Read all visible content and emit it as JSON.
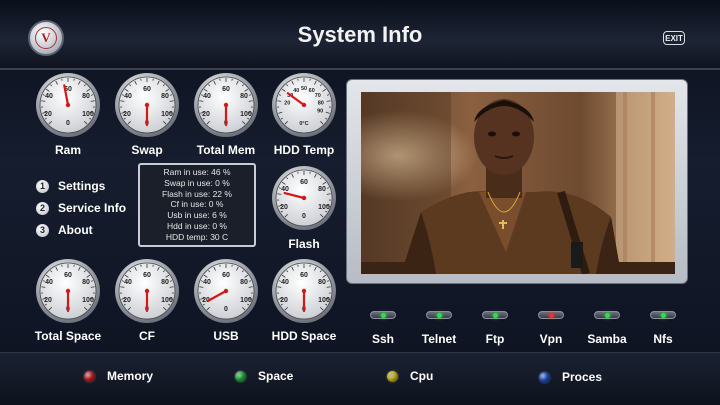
{
  "header": {
    "title": "System Info",
    "exit_label": "EXIT",
    "logo_letter": "V"
  },
  "gauges": [
    {
      "id": "ram",
      "label": "Ram",
      "percent": 46
    },
    {
      "id": "swap",
      "label": "Swap",
      "percent": 0
    },
    {
      "id": "total-mem",
      "label": "Total Mem",
      "percent": 0
    },
    {
      "id": "hdd-temp",
      "label": "HDD Temp",
      "percent": 30
    },
    {
      "id": "flash",
      "label": "Flash",
      "percent": 22
    },
    {
      "id": "total-space",
      "label": "Total Space",
      "percent": 0
    },
    {
      "id": "cf",
      "label": "CF",
      "percent": 0
    },
    {
      "id": "usb",
      "label": "USB",
      "percent": 6
    },
    {
      "id": "hdd-space",
      "label": "HDD Space",
      "percent": 0
    }
  ],
  "gauge_scale": [
    "20",
    "40",
    "60",
    "80",
    "100",
    "0"
  ],
  "temp_scale": [
    "20",
    "30",
    "40",
    "50",
    "60",
    "70",
    "80",
    "90",
    "0°C"
  ],
  "menu": [
    {
      "num": "1",
      "label": "Settings"
    },
    {
      "num": "2",
      "label": "Service Info"
    },
    {
      "num": "3",
      "label": "About"
    }
  ],
  "info": [
    "Ram in use: 46 %",
    "Swap in use: 0 %",
    "Flash in use: 22 %",
    "Cf in use: 0 %",
    "Usb in use: 6 %",
    "Hdd in use: 0 %",
    "HDD temp: 30 C"
  ],
  "services": [
    {
      "label": "Ssh",
      "active": "green"
    },
    {
      "label": "Telnet",
      "active": "green"
    },
    {
      "label": "Ftp",
      "active": "green"
    },
    {
      "label": "Vpn",
      "active": "red"
    },
    {
      "label": "Samba",
      "active": "green"
    },
    {
      "label": "Nfs",
      "active": "green"
    }
  ],
  "color_buttons": [
    {
      "color": "red",
      "hex": "#d42020",
      "label": "Memory"
    },
    {
      "color": "green",
      "hex": "#1fb33c",
      "label": "Space"
    },
    {
      "color": "yellow",
      "hex": "#d8c21a",
      "label": "Cpu"
    },
    {
      "color": "blue",
      "hex": "#2154d6",
      "label": "Proces"
    }
  ],
  "colors": {
    "needle": "#d41818",
    "led_green": "#2fe04a",
    "led_red": "#f03030",
    "led_off": "#4a4f59"
  }
}
